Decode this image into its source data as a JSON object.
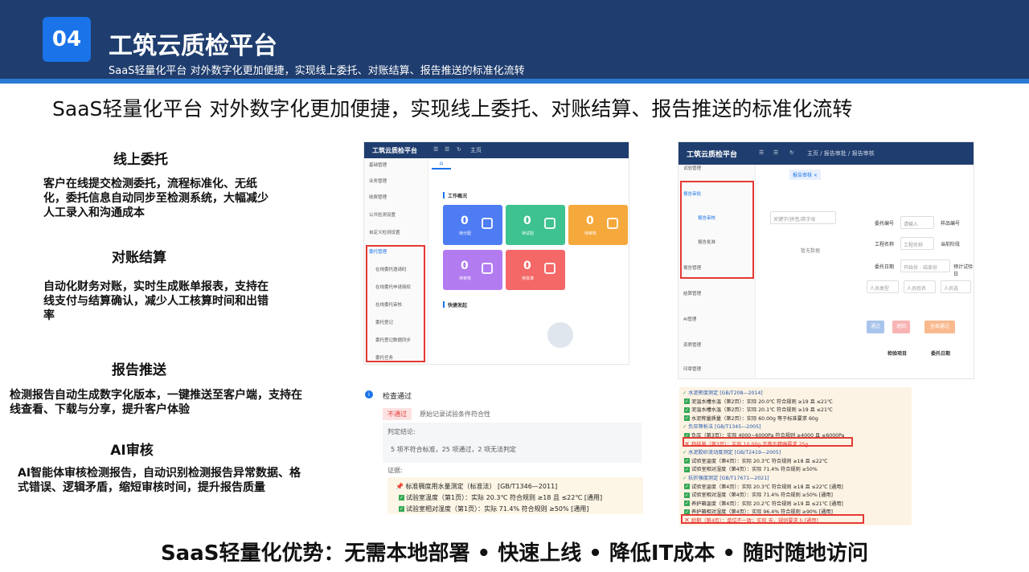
{
  "header": {
    "number": "04",
    "title": "工筑云质检平台",
    "subtitle": "SaaS轻量化平台  对外数字化更加便捷，实现线上委托、对账结算、报告推送的标准化流转"
  },
  "headline": "SaaS轻量化平台  对外数字化更加便捷，实现线上委托、对账结算、报告推送的标准化流转",
  "sections": [
    {
      "title": "线上委托",
      "body": "客户在线提交检测委托，流程标准化、无纸化，委托信息自动同步至检测系统，大幅减少人工录入和沟通成本"
    },
    {
      "title": "对账结算",
      "body": "自动化财务对账，实时生成账单报表，支持在线支付与结算确认，减少人工核算时间和出错率"
    },
    {
      "title": "报告推送",
      "body": "检测报告自动生成数字化版本，一键推送至客户端，支持在线查看、下载与分享，提升客户体验"
    },
    {
      "title": "AI审核",
      "body": "AI智能体审核检测报告，自动识别检测报告异常数据、格式错误、逻辑矛盾，缩短审核时间，提升报告质量"
    }
  ],
  "footer": "SaaS轻量化优势：无需本地部署 • 快速上线 • 降低IT成本 • 随时随地访问",
  "screen1": {
    "app_title": "工筑云质检平台",
    "top_label": "主页",
    "menu": [
      "基础管理",
      "业务管理",
      "收费管理",
      "公共检测设置",
      "自定义检测设置",
      "委托管理"
    ],
    "submenu": [
      "在线委托邀请码",
      "在线委托申请授权",
      "在线委托审核",
      "委托登记",
      "委托登记数据同步",
      "委托任务"
    ],
    "overview": "工作概况",
    "cards": [
      {
        "value": "0",
        "label": "待分配",
        "color": "#4e7cf3"
      },
      {
        "value": "0",
        "label": "待试验",
        "color": "#3ec28f"
      },
      {
        "value": "0",
        "label": "待审核",
        "color": "#f5a83b"
      },
      {
        "value": "0",
        "label": "待审核",
        "color": "#b27cf0"
      },
      {
        "value": "0",
        "label": "待批准",
        "color": "#f46868"
      }
    ],
    "quick": "快捷发起"
  },
  "screen2": {
    "app_title": "工筑云质检平台",
    "breadcrumb": "主页 / 报告审批 / 报告审核",
    "tab": "报告审核 ×",
    "menu_top": "试验管理",
    "menu_group": "报告审批",
    "menu_sub": [
      "报告审核",
      "报告批准"
    ],
    "menu_group2": "报告管理",
    "menu_rest": [
      "结算管理",
      "AI管理",
      "资质管理",
      "印章管理"
    ],
    "search_placeholder": "关键字(拼音/首字母",
    "empty": "暂无数据",
    "fields": [
      "委托编号",
      "样品编号",
      "工程名称",
      "当前阶段",
      "委托日期",
      "预计试验日"
    ],
    "inputs": [
      "请输入",
      "工程名称",
      "开始份 - 结束份"
    ],
    "selects": [
      "人员类型",
      "人员姓名",
      "人员选"
    ],
    "buttons": [
      {
        "label": "通过",
        "color": "#a8c4ea"
      },
      {
        "label": "退回",
        "color": "#f8b4b4"
      },
      {
        "label": "全部通过",
        "color": "#f9b98e"
      }
    ],
    "table_headers": [
      "检验项目",
      "委托日期"
    ]
  },
  "screen3": {
    "title": "检查通过",
    "tag": "不通过",
    "tag_text": "原始记录试验条件符合性",
    "judge_label": "判定结论:",
    "judge": "5 项不符合标准，25 项通过，2 项无法判定",
    "evidence_label": "证据:",
    "item_title": "标准稠度用水量测定（标准法）  [GB/T1346—2011]",
    "rows": [
      "试验室温度（第1页）：实际 20.3℃ 符合规则 ≥18 且 ≤22℃ [通用]",
      "试验室相对湿度（第1页）：实际 71.4% 符合规则 ≥50% [通用]"
    ]
  },
  "screen4": {
    "lines": [
      {
        "text": "水泥密度测定 [GB/T208—2014]",
        "kind": "h"
      },
      {
        "text": "泥温水槽水温（第2页）：实际 20.0℃ 符合规则 ≥19 且 ≤21℃",
        "kind": "ok"
      },
      {
        "text": "泥温水槽水温（第2页）：实际 20.1℃ 符合规则 ≥19 且 ≤21℃",
        "kind": "ok"
      },
      {
        "text": "水泥称量质量（第2页）：实际 60.00g 等于标准要求 60g",
        "kind": "ok"
      },
      {
        "text": "负压筛析法 [GB/T1345—2005]",
        "kind": "h"
      },
      {
        "text": "负压（第3页）：实际 4000~6000Pa 符合规则 ≥4000 且 ≤6000Pa",
        "kind": "ok"
      },
      {
        "text": "称样量（第3页）：实际 10.00g 不等于精确要求 25g",
        "kind": "bad"
      },
      {
        "text": "水泥胶砂流动度测定 [GB/T2419—2005]",
        "kind": "h"
      },
      {
        "text": "试验室温度（第4页）：实际 20.3℃ 符合规则 ≥18 且 ≤22℃",
        "kind": "ok"
      },
      {
        "text": "试验室相对湿度（第4页）：实际 71.4% 符合规则 ≥50%",
        "kind": "ok"
      },
      {
        "text": "抗折强度测定 [GB/T17671—2021]",
        "kind": "h"
      },
      {
        "text": "试验室温度（第4页）：实际 20.3℃ 符合规则 ≥18 且 ≤22℃ [通用]",
        "kind": "ok"
      },
      {
        "text": "试验室相对湿度（第4页）：实际 71.4% 符合规则 ≥50% [通用]",
        "kind": "ok"
      },
      {
        "text": "养护箱温度（第4页）：实际 20.2℃ 符合规则 ≥19 且 ≤21℃ [通用]",
        "kind": "ok"
      },
      {
        "text": "养护箱相对湿度（第4页）：实际 96.4% 符合规则 ≥90% [通用]",
        "kind": "ok"
      },
      {
        "text": "龄期（第4页）：单位不一致；实际 天，规则要求 h [通用]",
        "kind": "bad"
      }
    ]
  }
}
